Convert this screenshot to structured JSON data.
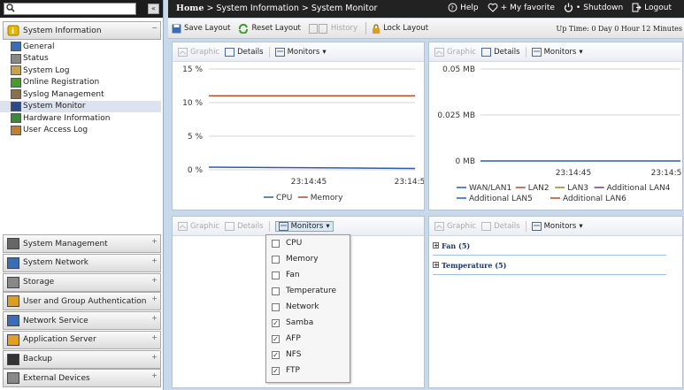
{
  "search": {
    "placeholder": ""
  },
  "sidebar": {
    "section_title": "System Information",
    "items": [
      {
        "label": "General",
        "icon": "general-icon"
      },
      {
        "label": "Status",
        "icon": "status-icon"
      },
      {
        "label": "System Log",
        "icon": "log-icon"
      },
      {
        "label": "Online Registration",
        "icon": "registration-icon"
      },
      {
        "label": "Syslog Management",
        "icon": "syslog-icon"
      },
      {
        "label": "System Monitor",
        "icon": "monitor-icon"
      },
      {
        "label": "Hardware Information",
        "icon": "hardware-icon"
      },
      {
        "label": "User Access Log",
        "icon": "user-log-icon"
      }
    ],
    "sections": [
      {
        "label": "System Management"
      },
      {
        "label": "System Network"
      },
      {
        "label": "Storage"
      },
      {
        "label": "User and Group Authentication"
      },
      {
        "label": "Network Service"
      },
      {
        "label": "Application Server"
      },
      {
        "label": "Backup"
      },
      {
        "label": "External Devices"
      }
    ]
  },
  "header": {
    "home": "Home",
    "crumb1": " > System Information > ",
    "crumb2": "System Monitor",
    "help": "Help",
    "favorite": "My favorite",
    "shutdown": "Shutdown",
    "logout": "Logout"
  },
  "toolbar": {
    "save": "Save Layout",
    "reset": "Reset Layout",
    "history": "History",
    "lock": "Lock Layout",
    "uptime": "Up Time:  0 Day 0 Hour 12 Minutes"
  },
  "panel_buttons": {
    "graphic": "Graphic",
    "details": "Details",
    "monitors": "Monitors"
  },
  "chart_data": [
    {
      "type": "line",
      "ylabels": [
        "15 %",
        "10 %",
        "5 %",
        "0 %"
      ],
      "yvalues": [
        15,
        10,
        5,
        0
      ],
      "ylim": [
        0,
        15
      ],
      "xlabels": [
        "23:14:45",
        "23:14:5"
      ],
      "series": [
        {
          "name": "CPU",
          "color": "#2a5ea8",
          "values": [
            0.4,
            0.2
          ]
        },
        {
          "name": "Memory",
          "color": "#b04a2a",
          "values": [
            11,
            11
          ]
        }
      ]
    },
    {
      "type": "line",
      "ylabels": [
        "0.05 MB",
        "0.025 MB",
        "0 MB"
      ],
      "yvalues": [
        0.05,
        0.025,
        0
      ],
      "ylim": [
        0,
        0.05
      ],
      "xlabels": [
        "23:14:45",
        "23:14:5"
      ],
      "series": [
        {
          "name": "WAN/LAN1",
          "color": "#2a5ea8",
          "values": [
            0,
            0
          ]
        },
        {
          "name": "LAN2",
          "color": "#b04a2a"
        },
        {
          "name": "LAN3",
          "color": "#8a8a20"
        },
        {
          "name": "Additional LAN4",
          "color": "#6a3a90"
        },
        {
          "name": "Additional LAN5",
          "color": "#2a5ea8"
        },
        {
          "name": "Additional LAN6",
          "color": "#b04a2a"
        }
      ]
    }
  ],
  "dropdown": {
    "items": [
      {
        "label": "CPU",
        "checked": false
      },
      {
        "label": "Memory",
        "checked": false
      },
      {
        "label": "Fan",
        "checked": false
      },
      {
        "label": "Temperature",
        "checked": false
      },
      {
        "label": "Network",
        "checked": false
      },
      {
        "label": "Samba",
        "checked": true
      },
      {
        "label": "AFP",
        "checked": true
      },
      {
        "label": "NFS",
        "checked": true
      },
      {
        "label": "FTP",
        "checked": true
      }
    ]
  },
  "details_tree": {
    "fan": "Fan (5)",
    "temperature": "Temperature (5)"
  }
}
